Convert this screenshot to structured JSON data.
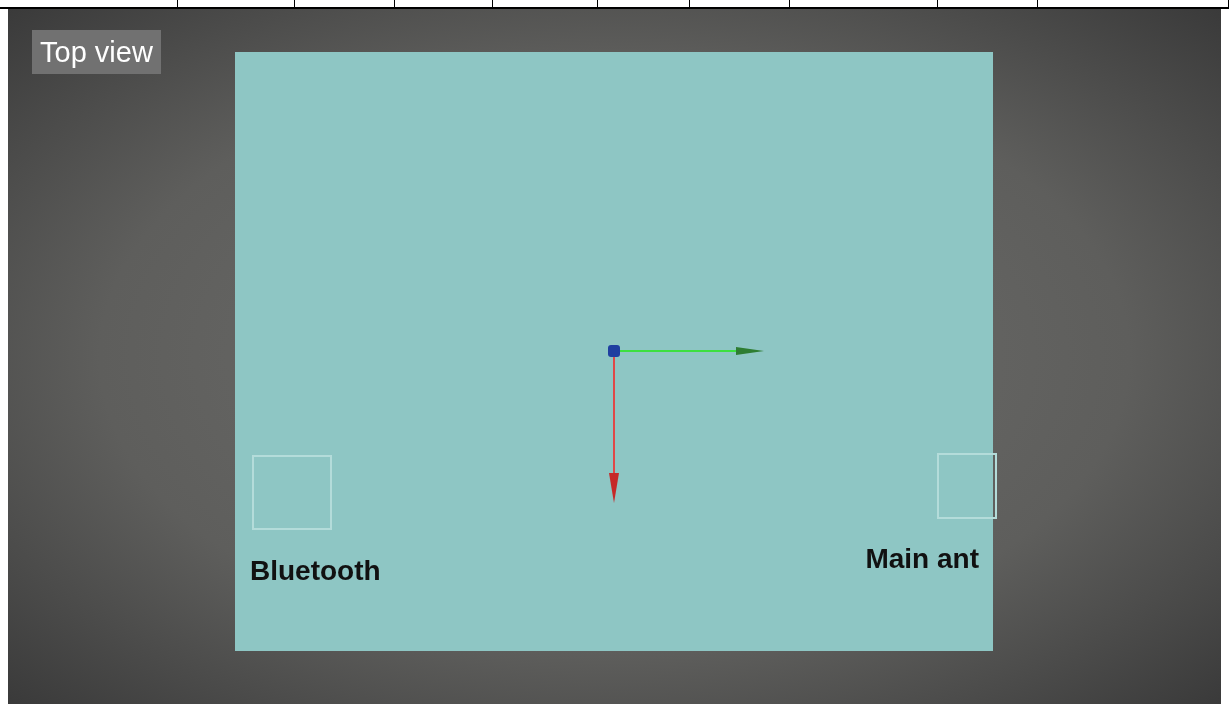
{
  "view_label": "Top view",
  "markers": [
    {
      "label": "Bluetooth"
    },
    {
      "label": "Main ant"
    }
  ]
}
